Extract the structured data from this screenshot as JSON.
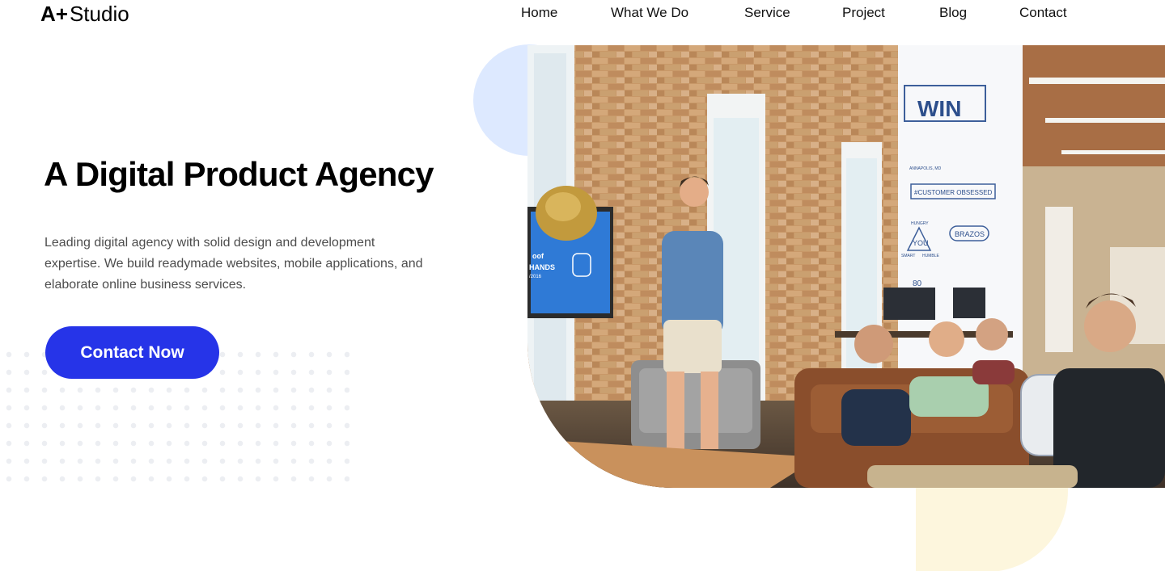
{
  "brand": {
    "mark": "A+",
    "name": "Studio"
  },
  "nav": {
    "items": [
      {
        "label": "Home"
      },
      {
        "label": "What We Do"
      },
      {
        "label": "Service"
      },
      {
        "label": "Project"
      },
      {
        "label": "Blog"
      },
      {
        "label": "Contact"
      }
    ]
  },
  "hero": {
    "title": "A Digital Product Agency",
    "description": "Leading digital agency with solid design and development expertise. We build readymade websites, mobile applications, and elaborate online business services.",
    "cta_label": "Contact Now",
    "mural_texts": {
      "win": "WIN",
      "obsessed": "#CUSTOMER OBSESSED",
      "brazos": "BRAZOS",
      "you": "YOU",
      "hungry": "HUNGRY",
      "smart": "SMART",
      "humble": "HUMBLE",
      "number": "80",
      "annapolis": "ANNAPOLIS, MD",
      "screen1": "oof",
      "screen2": "HANDS",
      "screen3": "/2016"
    }
  },
  "colors": {
    "primary": "#2634e8",
    "blue_circle": "#dde9ff",
    "yellow_shape": "#fdf6dd",
    "text_muted": "#4d4d4d",
    "dots": "#eceef2"
  }
}
